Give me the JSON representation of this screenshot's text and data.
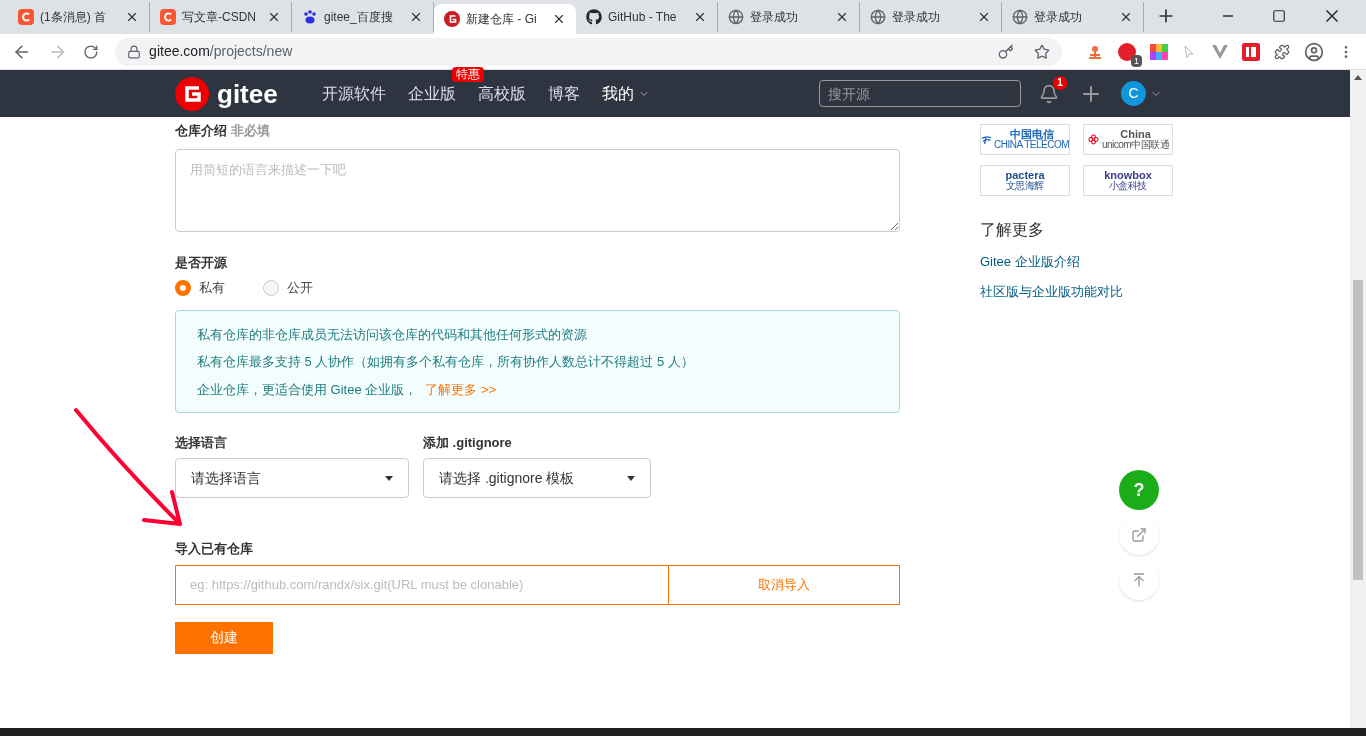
{
  "browser": {
    "tabs": [
      {
        "kind": "csdn",
        "title": "(1条消息) 首",
        "selected": false
      },
      {
        "kind": "csdn",
        "title": "写文章-CSDN",
        "selected": false
      },
      {
        "kind": "baidu",
        "title": "gitee_百度搜",
        "selected": false
      },
      {
        "kind": "gitee",
        "title": "新建仓库 - Gi",
        "selected": true
      },
      {
        "kind": "github",
        "title": "GitHub - The",
        "selected": false
      },
      {
        "kind": "globe",
        "title": "登录成功",
        "selected": false
      },
      {
        "kind": "globe",
        "title": "登录成功",
        "selected": false
      },
      {
        "kind": "globe",
        "title": "登录成功",
        "selected": false
      }
    ],
    "url_host": "gitee.com",
    "url_path": "/projects/new",
    "adblock_count": "1"
  },
  "navbar": {
    "logo": "gitee",
    "items": [
      {
        "label": "开源软件",
        "dropdown": false
      },
      {
        "label": "企业版",
        "badge": "特惠",
        "dropdown": false
      },
      {
        "label": "高校版",
        "dropdown": false
      },
      {
        "label": "博客",
        "dropdown": false
      },
      {
        "label": "我的",
        "dropdown": true
      }
    ],
    "search": {
      "placeholder": "搜开源"
    },
    "notifications": "1",
    "avatar": "C"
  },
  "form": {
    "description": {
      "label": "仓库介绍",
      "optional": "非必填",
      "placeholder": "用简短的语言来描述一下吧"
    },
    "visibility": {
      "label": "是否开源",
      "options": [
        {
          "label": "私有",
          "selected": true
        },
        {
          "label": "公开",
          "selected": false
        }
      ]
    },
    "notice": {
      "lines": [
        "私有仓库的非仓库成员无法访问该仓库的代码和其他任何形式的资源",
        "私有仓库最多支持 5 人协作（如拥有多个私有仓库，所有协作人数总计不得超过 5 人）",
        "企业仓库，更适合使用 Gitee 企业版，"
      ],
      "link": "了解更多 >>"
    },
    "language": {
      "label": "选择语言",
      "value": "请选择语言"
    },
    "gitignore": {
      "label": "添加 .gitignore",
      "value": "请选择 .gitignore 模板"
    },
    "import": {
      "label": "导入已有仓库",
      "placeholder": "eg: https://github.com/randx/six.git(URL must be clonable)",
      "cancel": "取消导入"
    },
    "submit": "创建"
  },
  "sidebar": {
    "partners": [
      {
        "kind": "telecom",
        "name": "中国电信",
        "sub": "CHINA TELECOM"
      },
      {
        "kind": "unicom",
        "name": "China",
        "sub": "unicom中国联通"
      },
      {
        "kind": "pactera",
        "name": "pactera",
        "sub": "文思海辉"
      },
      {
        "kind": "knowbox",
        "name": "knowbox",
        "sub": "小盒科技"
      }
    ],
    "learn_more": {
      "title": "了解更多",
      "links": [
        "Gitee 企业版介绍",
        "社区版与企业版功能对比"
      ]
    }
  },
  "floating": {
    "help": "?"
  }
}
